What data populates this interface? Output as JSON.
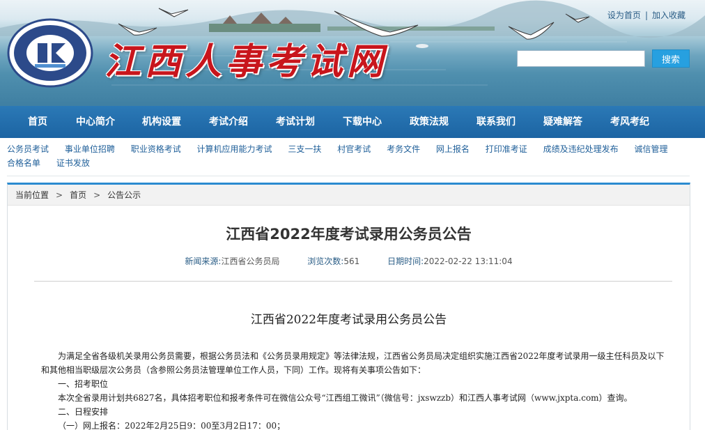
{
  "header": {
    "site_title": "江西人事考试网",
    "top_links": [
      "设为首页",
      "加入收藏"
    ],
    "top_links_separator": "|",
    "search_placeholder": "",
    "search_button": "搜索"
  },
  "main_nav": [
    "首页",
    "中心简介",
    "机构设置",
    "考试介绍",
    "考试计划",
    "下载中心",
    "政策法规",
    "联系我们",
    "疑难解答",
    "考风考纪"
  ],
  "sub_nav": [
    "公务员考试",
    "事业单位招聘",
    "职业资格考试",
    "计算机应用能力考试",
    "三支一扶",
    "村官考试",
    "考务文件",
    "网上报名",
    "打印准考证",
    "成绩及违纪处理发布",
    "诚信管理",
    "合格名单",
    "证书发放"
  ],
  "breadcrumb": {
    "label": "当前位置",
    "items": [
      "首页",
      "公告公示"
    ],
    "arrow": ">"
  },
  "article": {
    "title": "江西省2022年度考试录用公务员公告",
    "meta": {
      "source_label": "新闻来源:",
      "source": "江西省公务员局",
      "views_label": "浏览次数:",
      "views": "561",
      "date_label": "日期时间:",
      "date": "2022-02-22 13:11:04"
    },
    "doc_title": "江西省2022年度考试录用公务员公告",
    "paragraphs": [
      "为满足全省各级机关录用公务员需要，根据公务员法和《公务员录用规定》等法律法规，江西省公务员局决定组织实施江西省2022年度考试录用一级主任科员及以下和其他相当职级层次公务员（含参照公务员法管理单位工作人员，下同）工作。现将有关事项公告如下：",
      "一、招考职位",
      "本次全省录用计划共6827名，具体招考职位和报考条件可在微信公众号“江西组工微讯”（微信号：jxswzzb）和江西人事考试网（www.jxpta.com）查询。",
      "二、日程安排",
      "（一）网上报名：2022年2月25日9：00至3月2日17：00；"
    ]
  },
  "colors": {
    "nav_blue": "#1c64a3",
    "title_red": "#c8151c",
    "link_blue": "#1f5f99",
    "accent_blue": "#2b8bd0",
    "search_button": "#27a0e0"
  }
}
